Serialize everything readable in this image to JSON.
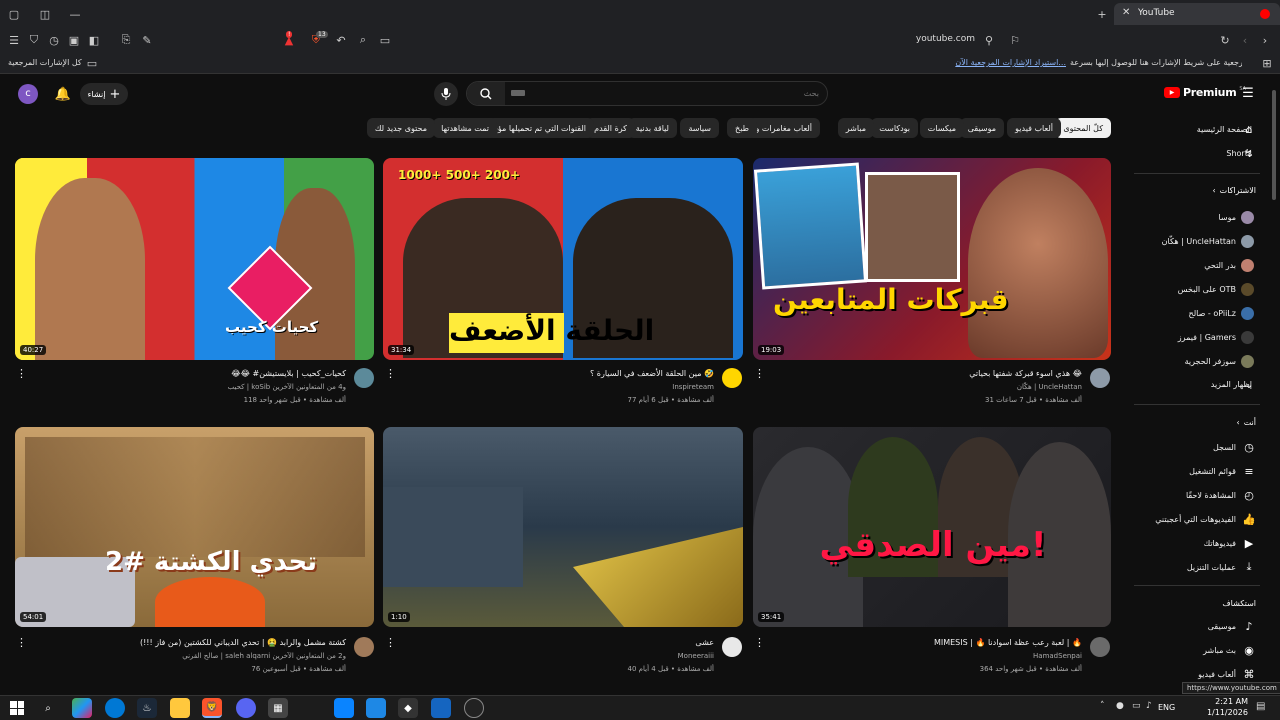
{
  "browser": {
    "tab_title": "YouTube",
    "url": "youtube.com",
    "badge_count": "13",
    "bookmarks_prompt": "ضع إشارات المرجعية على شريط الإشارات هنا للوصول إليها بسرعة.",
    "bookmarks_import": "استيراد الإشارات المرجعية الآن...",
    "bookmarks_all": "كل الإشارات المرجعية"
  },
  "header": {
    "logo_text": "Premium",
    "logo_superscript": "SA",
    "search_placeholder": "بحث",
    "create_label": "إنشاء",
    "avatar_letter": "c"
  },
  "chips": [
    "كلّ المحتوى",
    "ألعاب فيديو",
    "موسيقى",
    "ميكسات",
    "بودكاست",
    "مباشر",
    "ألعاب مغامرات وحركة",
    "طبخ",
    "سياسة",
    "لياقة بدنية",
    "كرة القدم",
    "القنوات التي تم تحميلها مؤخرًا",
    "تمت مشاهدتها",
    "محتوى جديد لك"
  ],
  "videos": [
    {
      "title": "هذي اسوء قبركة شفتها بحياتي 😂",
      "channel": "هكّان | UncleHattan",
      "stats": "31 ألف مشاهدة • قبل 7 ساعات",
      "duration": "19:03",
      "overlay": "قبركات المتابعين"
    },
    {
      "title": "مين الحلقة الأضعف في السيارة ؟ 🤣",
      "channel": "Inspireteam",
      "stats": "77 ألف مشاهدة • قبل 6 أيام",
      "duration": "31:34",
      "overlay": "الحلقة الأضعف"
    },
    {
      "title": "😂😂 #كحيات_كحيب | بلايستيشن",
      "channel": "كحيب | koSib و4 من المتعاونين الآخرين",
      "stats": "118 ألف مشاهدة • قبل شهر واحد",
      "duration": "40:27",
      "overlay": "كحيات كحيب"
    },
    {
      "title": "MIMESIS | 🔥 لعبة رعب عظة اسوادنا | 🔥",
      "channel": "HamadSenpai",
      "stats": "364 ألف مشاهدة • قبل شهر واحد",
      "duration": "35:41",
      "overlay": "مين الصدقي!"
    },
    {
      "title": "عشى",
      "channel": "Moneeraiii",
      "stats": "40 ألف مشاهدة • قبل 4 أيام",
      "duration": "1:10",
      "overlay": ""
    },
    {
      "title": "كشتة مشمل والرابد 🤮 | تحدي الديباني للكشتين (من فاز !!!)",
      "channel": "صالح القرني | saleh alqarni و2 من المتعاونين الآخرين",
      "stats": "76 ألف مشاهدة • قبل أسبوعين",
      "duration": "54:01",
      "overlay": "تحدي الكشتة #2"
    }
  ],
  "sidebar": {
    "home": "الصفحة الرئيسية",
    "shorts": "Shorts",
    "subs_title": "الاشتراكات",
    "subs": [
      "موسا",
      "هكّان | UncleHattan",
      "بدر التحي",
      "على البخس OTB",
      "صالح - oPiiLz",
      "فيمرز | Gamers",
      "سوزفر الحجرية"
    ],
    "show_more": "إظهار المزيد",
    "you_title": "أنت",
    "you_items": [
      "السجل",
      "قوائم التشغيل",
      "المشاهدة لاحقًا",
      "الفيديوهات التي أعجبتني",
      "فيديوهاتك",
      "عمليات التنزيل"
    ],
    "explore_title": "استكشاف",
    "explore_items": [
      "موسيقى",
      "بث مباشر",
      "ألعاب فيديو"
    ]
  },
  "statusbar": {
    "url": "https://www.youtube.com"
  },
  "taskbar": {
    "lang": "ENG",
    "time": "2:21 AM",
    "date": "1/11/2026"
  },
  "colors": {
    "yt_red": "#ff0000",
    "chip_bg": "#272727",
    "bg": "#0f0f0f"
  }
}
